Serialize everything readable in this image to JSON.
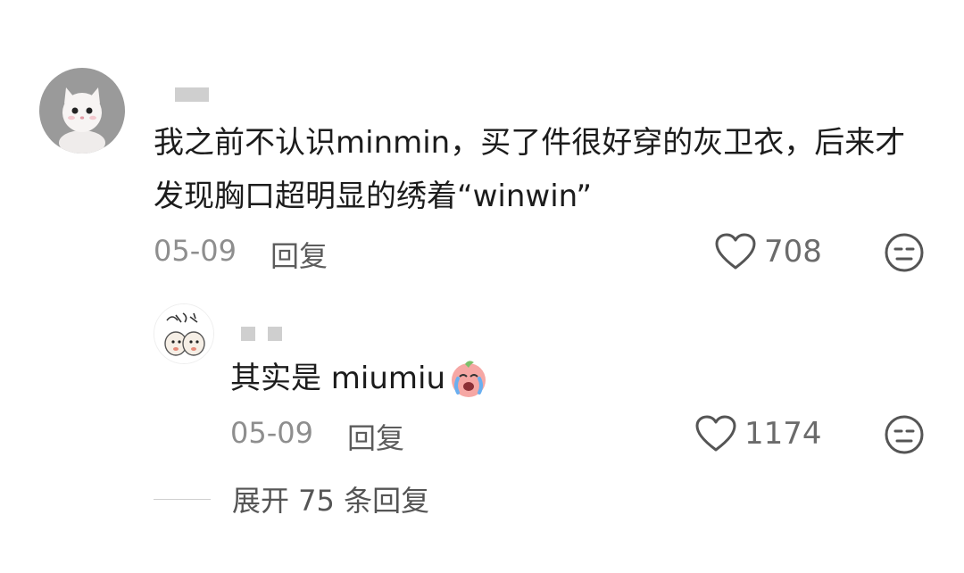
{
  "comments": [
    {
      "text": "我之前不认识minmin，买了件很好穿的灰卫衣，后来才发现胸口超明显的绣着“winwin”",
      "date": "05-09",
      "reply_label": "回复",
      "likes": "708",
      "avatar_icon": "white-cat-avatar-icon",
      "like_icon": "heart-outline-icon",
      "dislike_icon": "neutral-face-icon"
    },
    {
      "text": "其实是 miumiu",
      "emoji_icon": "crying-peach-emoji-icon",
      "date": "05-09",
      "reply_label": "回复",
      "likes": "1174",
      "avatar_icon": "doodle-ghost-avatar-icon",
      "like_icon": "heart-outline-icon",
      "dislike_icon": "neutral-face-icon"
    }
  ],
  "expand_label": "展开 75 条回复"
}
